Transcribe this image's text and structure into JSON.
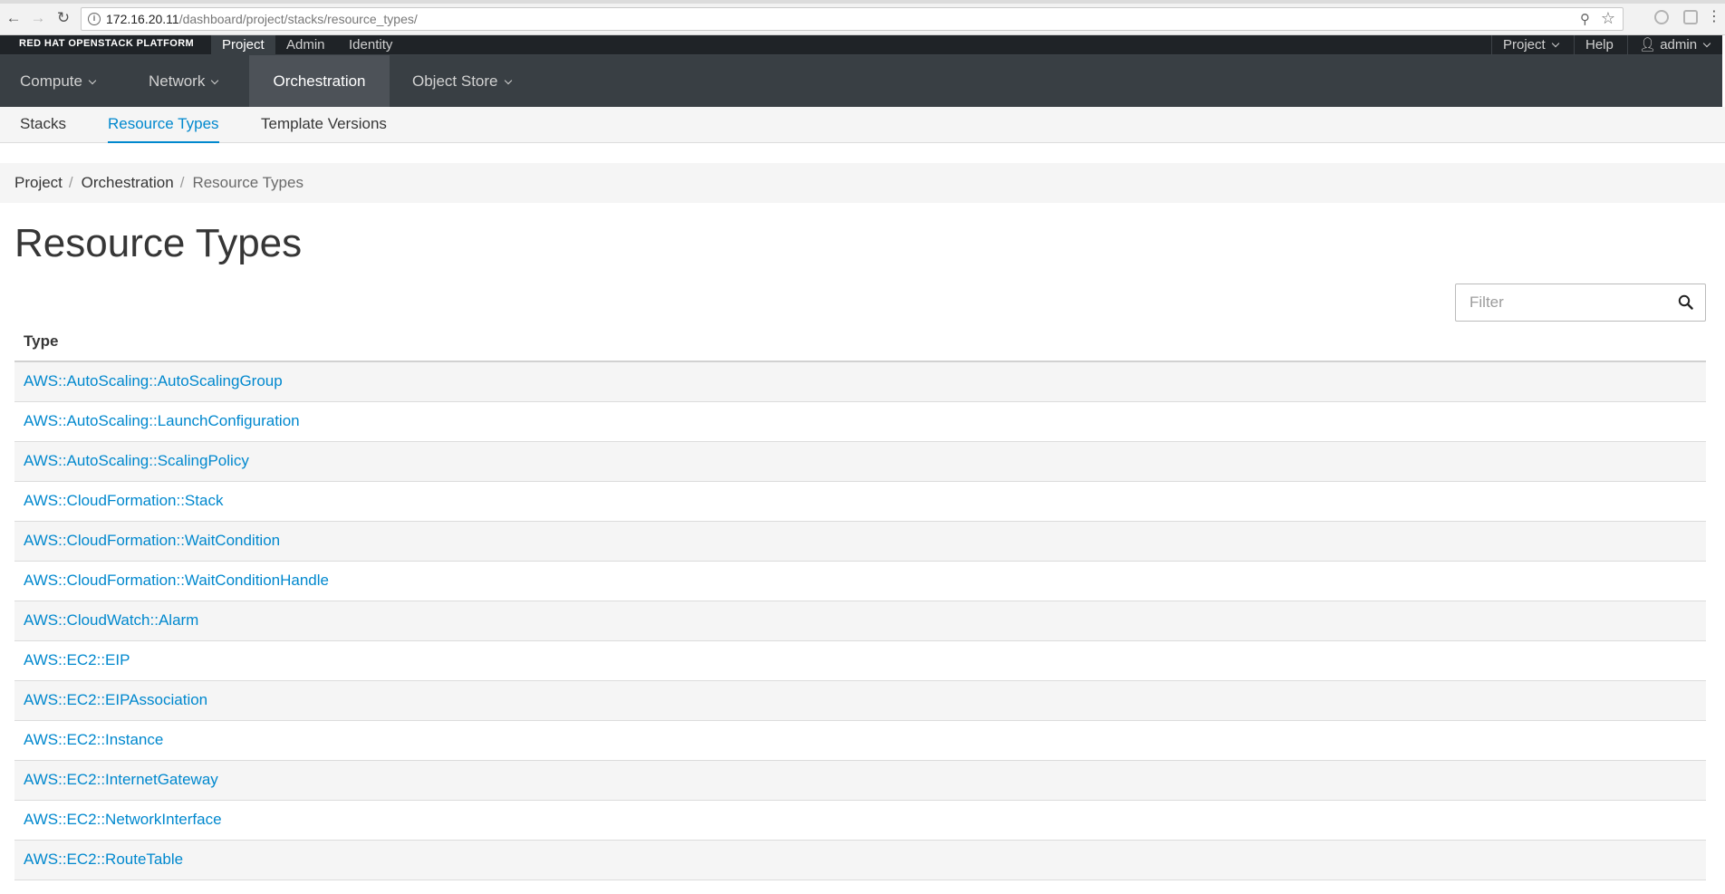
{
  "browser": {
    "url_host": "172.16.20.11",
    "url_path": "/dashboard/project/stacks/resource_types/"
  },
  "masthead": {
    "brand": "RED HAT OPENSTACK PLATFORM",
    "util_tabs": [
      "Project",
      "Admin",
      "Identity"
    ],
    "util_right": {
      "project_menu": "Project",
      "help": "Help",
      "user": "admin"
    }
  },
  "primary_nav": [
    "Compute",
    "Network",
    "Orchestration",
    "Object Store"
  ],
  "secondary_nav": [
    "Stacks",
    "Resource Types",
    "Template Versions"
  ],
  "breadcrumb": [
    "Project",
    "Orchestration",
    "Resource Types"
  ],
  "page_title": "Resource Types",
  "filter": {
    "placeholder": "Filter"
  },
  "table": {
    "header": "Type",
    "rows": [
      "AWS::AutoScaling::AutoScalingGroup",
      "AWS::AutoScaling::LaunchConfiguration",
      "AWS::AutoScaling::ScalingPolicy",
      "AWS::CloudFormation::Stack",
      "AWS::CloudFormation::WaitCondition",
      "AWS::CloudFormation::WaitConditionHandle",
      "AWS::CloudWatch::Alarm",
      "AWS::EC2::EIP",
      "AWS::EC2::EIPAssociation",
      "AWS::EC2::Instance",
      "AWS::EC2::InternetGateway",
      "AWS::EC2::NetworkInterface",
      "AWS::EC2::RouteTable"
    ]
  },
  "colors": {
    "link": "#0088ce",
    "masthead": "#393f44",
    "util_bar": "#1f2327",
    "active_nav": "#4d5258"
  }
}
